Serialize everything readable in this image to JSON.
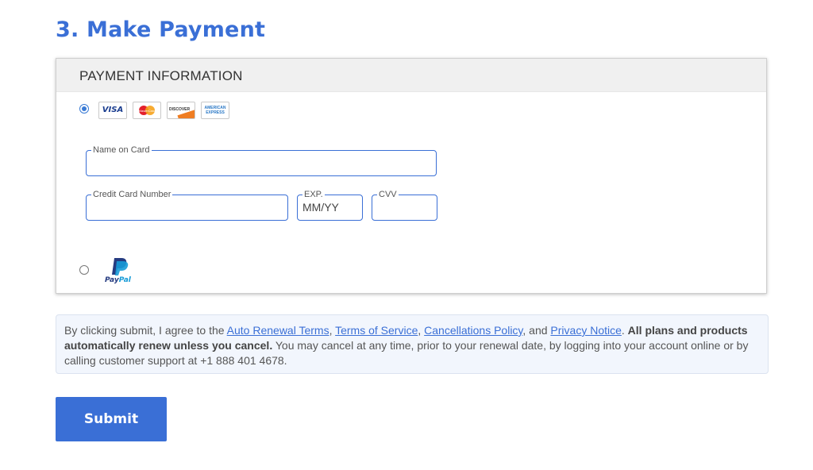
{
  "section": {
    "title": "3. Make Payment"
  },
  "payment": {
    "header": "PAYMENT INFORMATION",
    "card_option": {
      "selected": true,
      "logos": [
        {
          "name": "visa-logo",
          "text": "VISA",
          "color": "#1a3d8f"
        },
        {
          "name": "mastercard-logo",
          "text": "MasterCard",
          "color": "#e3202c"
        },
        {
          "name": "discover-logo",
          "text": "DISCOVER",
          "color": "#ef7d22"
        },
        {
          "name": "amex-logo",
          "text": "AMERICAN EXPRESS",
          "color": "#2a78c6"
        }
      ]
    },
    "fields": {
      "name_on_card": {
        "label": "Name on Card",
        "value": ""
      },
      "card_number": {
        "label": "Credit Card Number",
        "value": ""
      },
      "exp": {
        "label": "EXP.",
        "value": "MM/YY"
      },
      "cvv": {
        "label": "CVV",
        "value": ""
      }
    },
    "paypal_option": {
      "selected": false,
      "logo_pay": "Pay",
      "logo_pal": "Pal",
      "colors": {
        "dark": "#253b80",
        "light": "#179bd7"
      }
    }
  },
  "terms": {
    "prefix": "By clicking submit, I agree to the ",
    "link_auto_renewal": "Auto Renewal Terms",
    "sep1": ", ",
    "link_tos": "Terms of Service",
    "sep2": ", ",
    "link_cancellations": "Cancellations Policy",
    "sep3": ", and ",
    "link_privacy": "Privacy Notice",
    "sep4": ". ",
    "bold": "All plans and products automatically renew unless you cancel.",
    "suffix": " You may cancel at any time, prior to your renewal date, by logging into your account online or by calling customer support at +1 888 401 4678."
  },
  "submit": {
    "label": "Submit"
  },
  "colors": {
    "accent": "#3a6fd6",
    "terms_bg": "#f2f6fd",
    "header_bg": "#f0f0f0"
  }
}
